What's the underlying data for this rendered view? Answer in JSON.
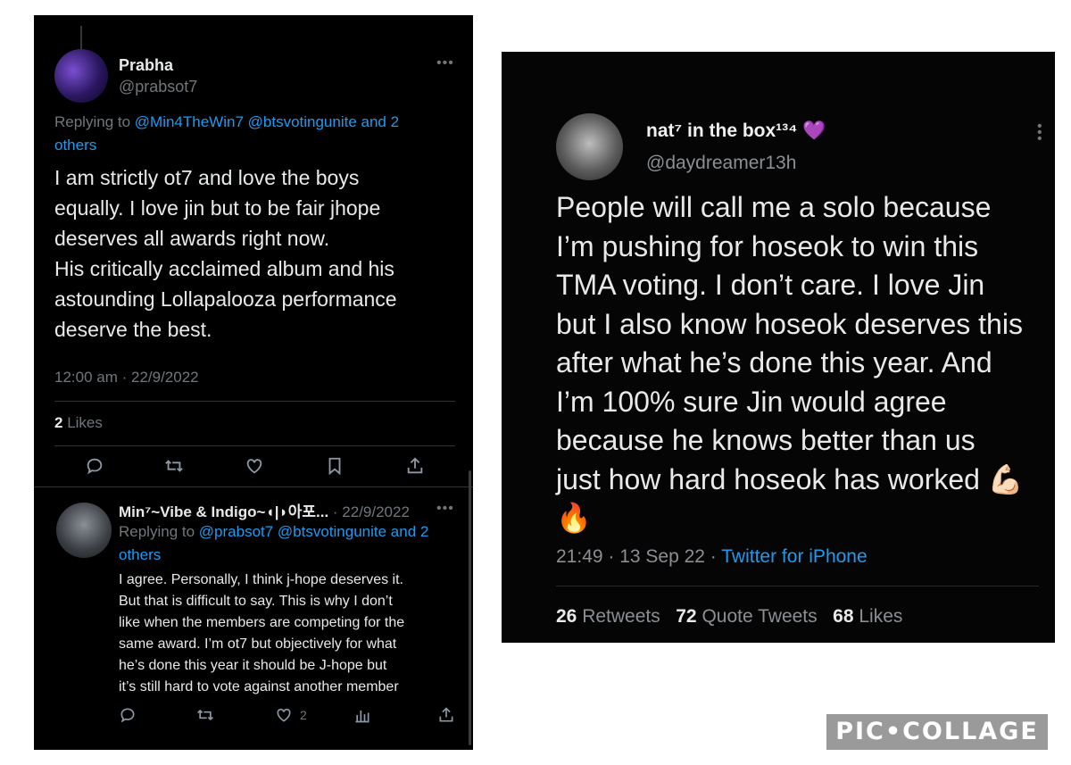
{
  "left_tweet": {
    "author_name": "Prabha",
    "handle": "@prabsot7",
    "replying_prefix": "Replying to ",
    "replying_users": "@Min4TheWin7 @btsvotingunite and 2",
    "replying_others": "others",
    "body_lines": [
      "I am strictly ot7 and love the boys",
      "equally. I love jin but to be fair jhope",
      "deserves all awards right now.",
      "His critically acclaimed album and his",
      "astounding Lollapalooza performance",
      "deserve the best."
    ],
    "timestamp": "12:00 am · 22/9/2022",
    "likes_count": "2",
    "likes_label": " Likes"
  },
  "left_reply": {
    "author_name": "Min⁷~Vibe & Indigo~◖|◗아포...",
    "date": " · 22/9/2022",
    "replying_prefix": "Replying to ",
    "replying_users": "@prabsot7 @btsvotingunite and 2",
    "replying_others": "others",
    "body_lines": [
      "I agree. Personally, I think j-hope deserves it.",
      "But that is difficult to say. This is why I don’t",
      "like when the members are competing for the",
      "same award. I’m ot7 but objectively for what",
      "he’s done this year it should be J-hope but",
      "it’s still hard to vote against another member"
    ],
    "like_count": "2"
  },
  "right_tweet": {
    "author_name": "nat⁷ in the box¹³⁴",
    "heart_emoji": "💜",
    "handle": "@daydreamer13h",
    "body_lines": [
      "People will call me a solo because",
      "I’m pushing for hoseok to win this",
      "TMA voting. I don’t care. I love Jin",
      "but I also know hoseok deserves this",
      "after what he’s done this year. And",
      "I’m 100% sure Jin would agree",
      "because he knows better than us",
      "just how hard hoseok has worked 💪🏻",
      "🔥"
    ],
    "timestamp": "21:49 · 13 Sep 22 · ",
    "source": "Twitter for iPhone",
    "retweets_count": "26",
    "retweets_label": " Retweets",
    "quotes_count": "72",
    "quotes_label": " Quote Tweets",
    "likes_count": "68",
    "likes_label": " Likes"
  },
  "watermark": "PIC•COLLAGE",
  "colors": {
    "accent": "#1d9bf0",
    "secondary_text": "#71767b",
    "text": "#e7e9ea",
    "heart": "#c04ddf"
  }
}
